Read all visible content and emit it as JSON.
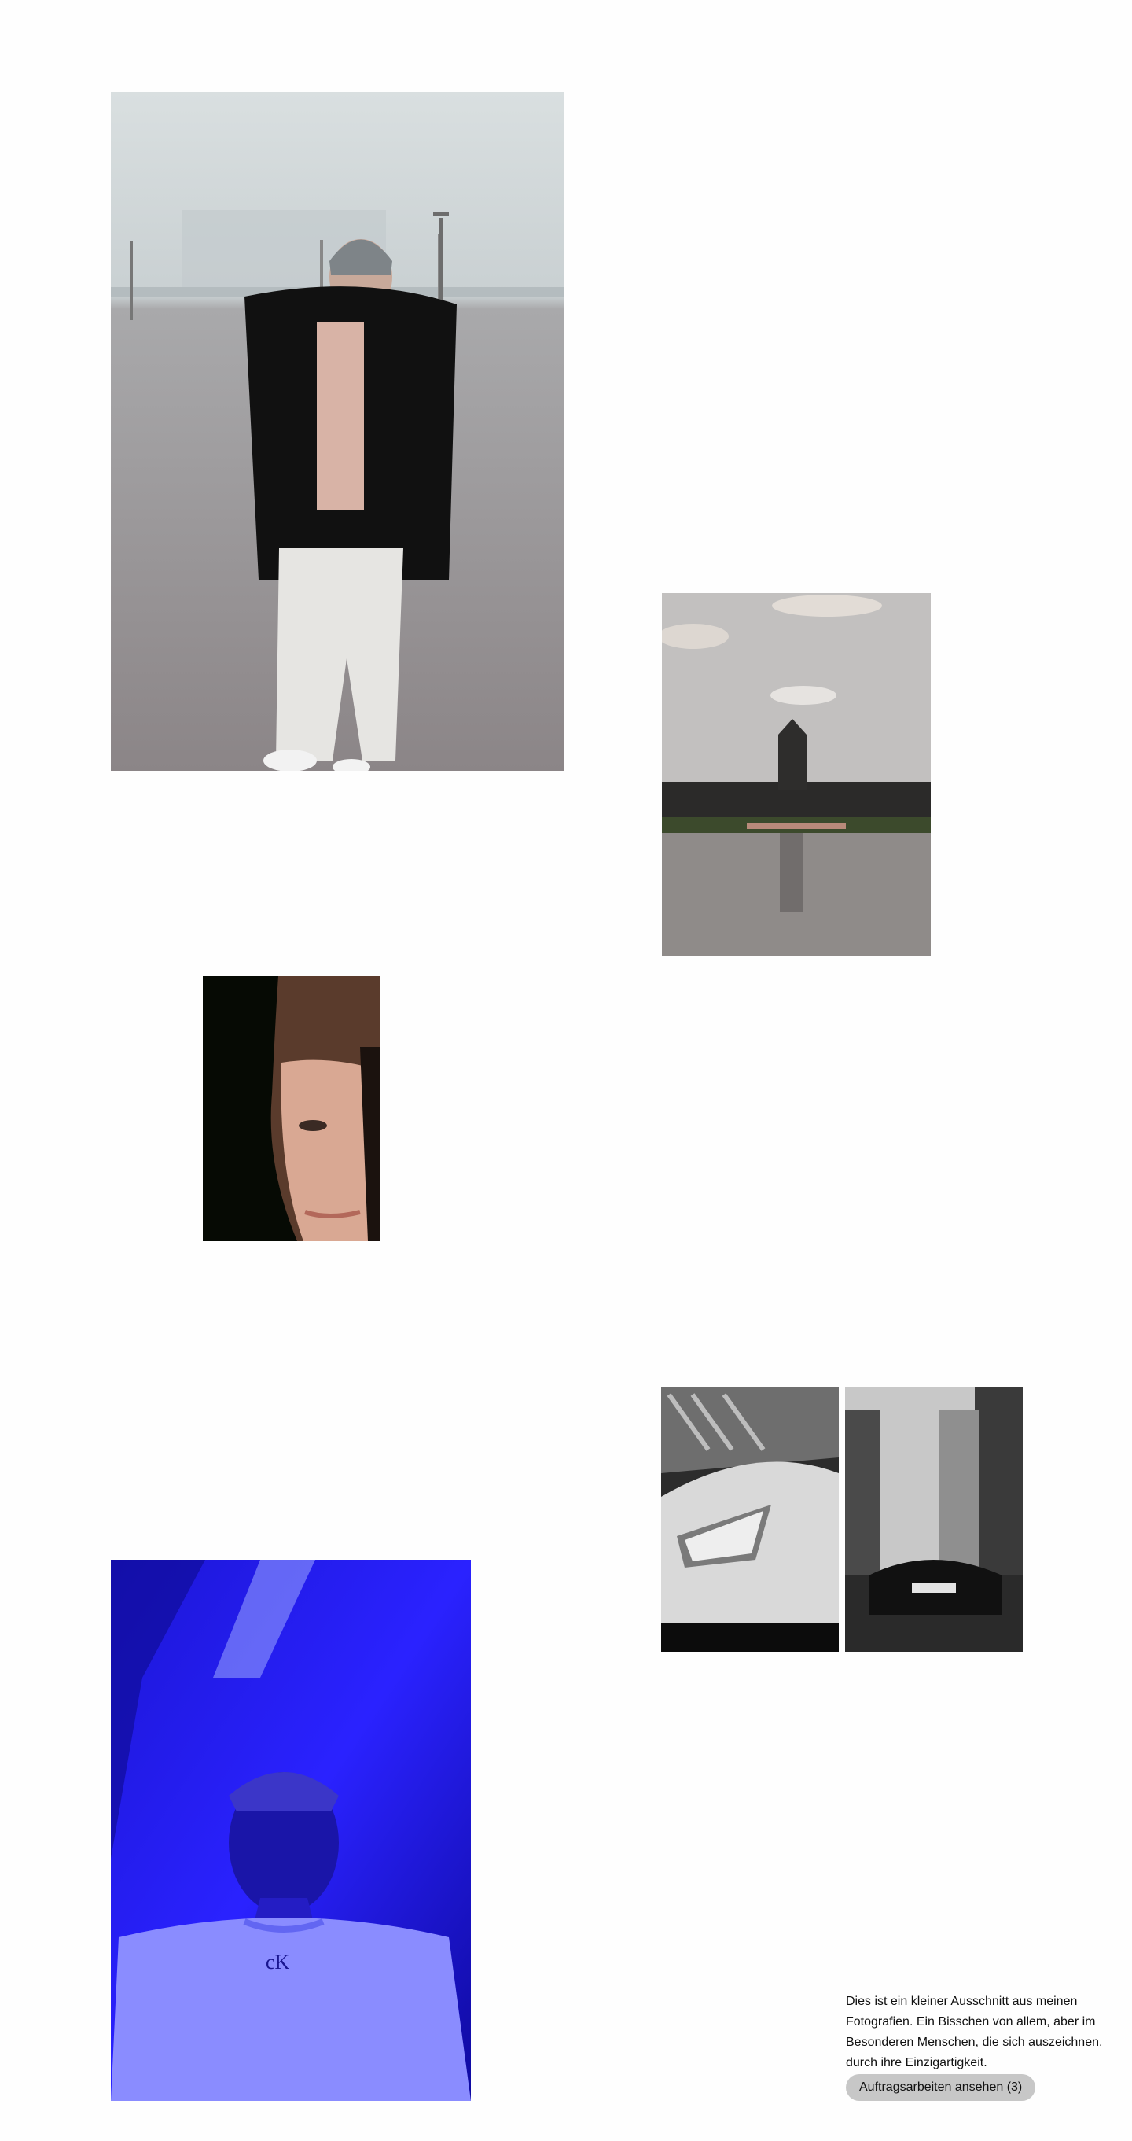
{
  "gallery": {
    "photos": [
      {
        "subject": "young man in black puffer jacket and grey beanie on a foggy lot"
      },
      {
        "subject": "palace with clock tower reflected in a pond"
      },
      {
        "subject": "half-lit face close-up"
      },
      {
        "subject": "black and white sports car headlight close-up"
      },
      {
        "subject": "black and white sports car on a city street"
      },
      {
        "subject": "young man in white t-shirt under blue light"
      }
    ]
  },
  "intro": {
    "text": "Dies ist ein kleiner Ausschnitt aus meinen Fotografien. Ein Bisschen von allem, aber im Besonderen Menschen, die sich auszeichnen, durch ihre Einzigartigkeit.",
    "cta_label": "Auftragsarbeiten ansehen (3)"
  },
  "colors": {
    "background": "#fefefe",
    "button": "#c7c7c7",
    "blue_light": "#3b2fff"
  }
}
